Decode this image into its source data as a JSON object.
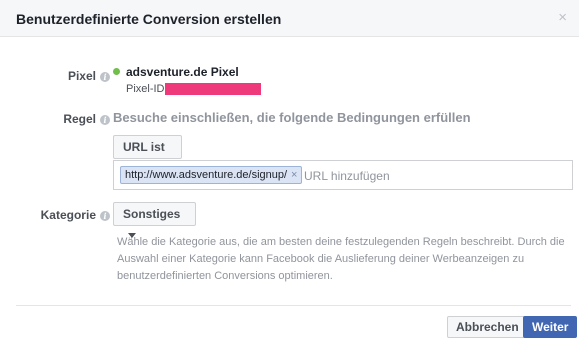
{
  "dialog": {
    "title": "Benutzerdefinierte Conversion erstellen",
    "close_glyph": "×"
  },
  "pixel": {
    "label": "Pixel",
    "status_color": "#6fbf4a",
    "name": "adsventure.de Pixel",
    "id_label": "Pixel-ID:"
  },
  "regel": {
    "label": "Regel",
    "description": "Besuche einschließen, die folgende Bedingungen erfüllen",
    "condition_dropdown": "URL ist",
    "url_token": "http://www.adsventure.de/signup/",
    "url_placeholder": "URL hinzufügen"
  },
  "kategorie": {
    "label": "Kategorie",
    "selected": "Sonstiges",
    "help_text": "Wähle die Kategorie aus, die am besten deine festzulegenden Regeln beschreibt. Durch die Auswahl einer Kategorie kann Facebook die Auslieferung deiner Werbeanzeigen zu benutzerdefinierten Conversions optimieren."
  },
  "footer": {
    "cancel_label": "Abbrechen",
    "next_label": "Weiter"
  },
  "colors": {
    "accent": "#4267b2",
    "redaction": "#ee3a7b"
  }
}
